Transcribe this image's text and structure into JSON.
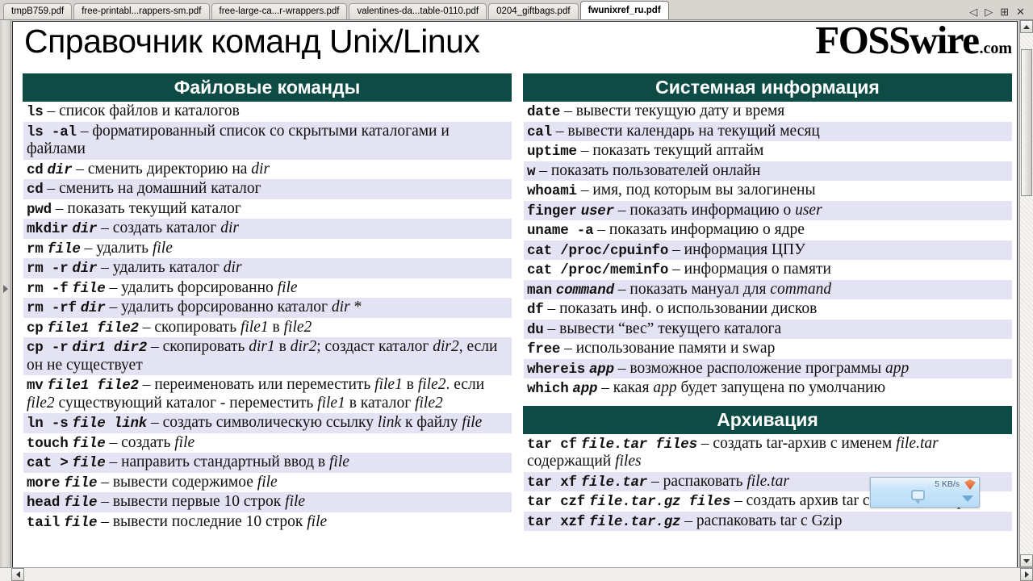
{
  "tabbar": {
    "tabs": [
      {
        "label": "tmpB759.pdf",
        "active": false
      },
      {
        "label": "free-printabl...rappers-sm.pdf",
        "active": false
      },
      {
        "label": "free-large-ca...r-wrappers.pdf",
        "active": false
      },
      {
        "label": "valentines-da...table-0110.pdf",
        "active": false
      },
      {
        "label": "0204_giftbags.pdf",
        "active": false
      },
      {
        "label": "fwunixref_ru.pdf",
        "active": true
      }
    ],
    "controls": [
      {
        "name": "prev-tab-icon",
        "glyph": "◁"
      },
      {
        "name": "next-tab-icon",
        "glyph": "▷"
      },
      {
        "name": "tile-windows-icon",
        "glyph": "⊞"
      },
      {
        "name": "close-tab-icon",
        "glyph": "✕"
      }
    ]
  },
  "document": {
    "title": "Справочник команд Unix/Linux",
    "logo_main": "FOSSwire",
    "logo_tld": ".com",
    "accent_color": "#0d4b44",
    "row_alt_color": "#e3e3f3"
  },
  "sections": [
    {
      "id": "file-commands",
      "column": "left",
      "title": "Файловые команды",
      "rows": [
        "<span class=\"cmd\">ls</span> – список файлов и каталогов",
        "<span class=\"cmd\">ls -al</span> – форматированный список со скрытыми каталогами и файлами",
        "<span class=\"cmd\">cd</span> <span class=\"arg\">dir</span> – сменить директорию на <em>dir</em>",
        "<span class=\"cmd\">cd</span> – сменить на домашний каталог",
        "<span class=\"cmd\">pwd</span> – показать текущий каталог",
        "<span class=\"cmd\">mkdir</span> <span class=\"arg\">dir</span> – создать каталог <em>dir</em>",
        "<span class=\"cmd\">rm</span> <span class=\"arg\">file</span> – удалить <em>file</em>",
        "<span class=\"cmd\">rm -r</span> <span class=\"arg\">dir</span> – удалить каталог <em>dir</em>",
        "<span class=\"cmd\">rm -f</span> <span class=\"arg\">file</span> – удалить форсированно <em>file</em>",
        "<span class=\"cmd\">rm -rf</span> <span class=\"arg\">dir</span> – удалить форсированно каталог <em>dir</em> *",
        "<span class=\"cmd\">cp</span> <span class=\"arg\">file1 file2</span> – скопировать <em>file1</em> в <em>file2</em>",
        "<span class=\"cmd\">cp -r</span> <span class=\"arg\">dir1 dir2</span> – скопировать <em>dir1</em> в <em>dir2</em>; создаст каталог <em>dir2</em>, если он не существует",
        "<span class=\"cmd\">mv</span> <span class=\"arg\">file1 file2</span> – переименовать или переместить <em>file1</em> в <em>file2</em>. если <em>file2</em> существующий каталог - переместить <em>file1</em> в каталог <em>file2</em>",
        "<span class=\"cmd\">ln -s</span> <span class=\"arg\">file link</span> – создать символическую ссылку <em>link</em> к файлу <em>file</em>",
        "<span class=\"cmd\">touch</span> <span class=\"arg\">file</span> – создать <em>file</em>",
        "<span class=\"cmd\">cat &gt;</span> <span class=\"arg\">file</span> – направить стандартный ввод в <em>file</em>",
        "<span class=\"cmd\">more</span> <span class=\"arg\">file</span> – вывести содержимое <em>file</em>",
        "<span class=\"cmd\">head</span> <span class=\"arg\">file</span> – вывести первые 10 строк <em>file</em>",
        "<span class=\"cmd\">tail</span> <span class=\"arg\">file</span> – вывести последние 10 строк <em>file</em>"
      ]
    },
    {
      "id": "system-information",
      "column": "right",
      "title": "Системная информация",
      "rows": [
        "<span class=\"cmd\">date</span> – вывести текущую дату и время",
        "<span class=\"cmd\">cal</span> – вывести календарь на текущий месяц",
        "<span class=\"cmd\">uptime</span> – показать текущий аптайм",
        "<span class=\"cmd\">w</span> – показать пользователей онлайн",
        "<span class=\"cmd\">whoami</span> –  имя, под которым вы залогинены",
        "<span class=\"cmd\">finger</span> <span class=\"arg\">user</span> – показать информацию о <em>user</em>",
        "<span class=\"cmd\">uname -a</span> – показать информацию о ядре",
        "<span class=\"cmd\">cat /proc/cpuinfo</span> – информация ЦПУ",
        "<span class=\"cmd\">cat /proc/meminfo</span> – информация о памяти",
        "<span class=\"cmd\">man</span> <span class=\"arg\">command</span> – показать мануал для <em>command</em>",
        "<span class=\"cmd\">df</span> – показать инф. о использовании дисков",
        "<span class=\"cmd\">du</span> – вывести “вес” текущего каталога",
        "<span class=\"cmd\">free</span> – использование памяти и swap",
        "<span class=\"cmd\">whereis</span> <span class=\"arg\">app</span> – возможное расположение программы <em>app</em>",
        "<span class=\"cmd\">which</span> <span class=\"arg\">app</span> – какая <em>app</em> будет запущена по умолчанию"
      ]
    },
    {
      "id": "archiving",
      "column": "right",
      "title": "Архивация",
      "rows": [
        "<span class=\"cmd\">tar cf</span> <span class=\"arg\">file.tar files</span> – создать tar-архив  с именем <em>file.tar</em> содержащий <em>files</em>",
        "<span class=\"cmd\">tar xf</span> <span class=\"arg\">file.tar</span> – распаковать <em>file.tar</em>",
        "<span class=\"cmd\">tar czf</span> <span class=\"arg\">file.tar.gz files</span> – создать архив tar с сжатием Gzip",
        "<span class=\"cmd\">tar xzf</span> <span class=\"arg\">file.tar.gz</span> – распаковать tar с Gzip"
      ]
    }
  ],
  "download_widget": {
    "speed": "5 KB/s"
  }
}
